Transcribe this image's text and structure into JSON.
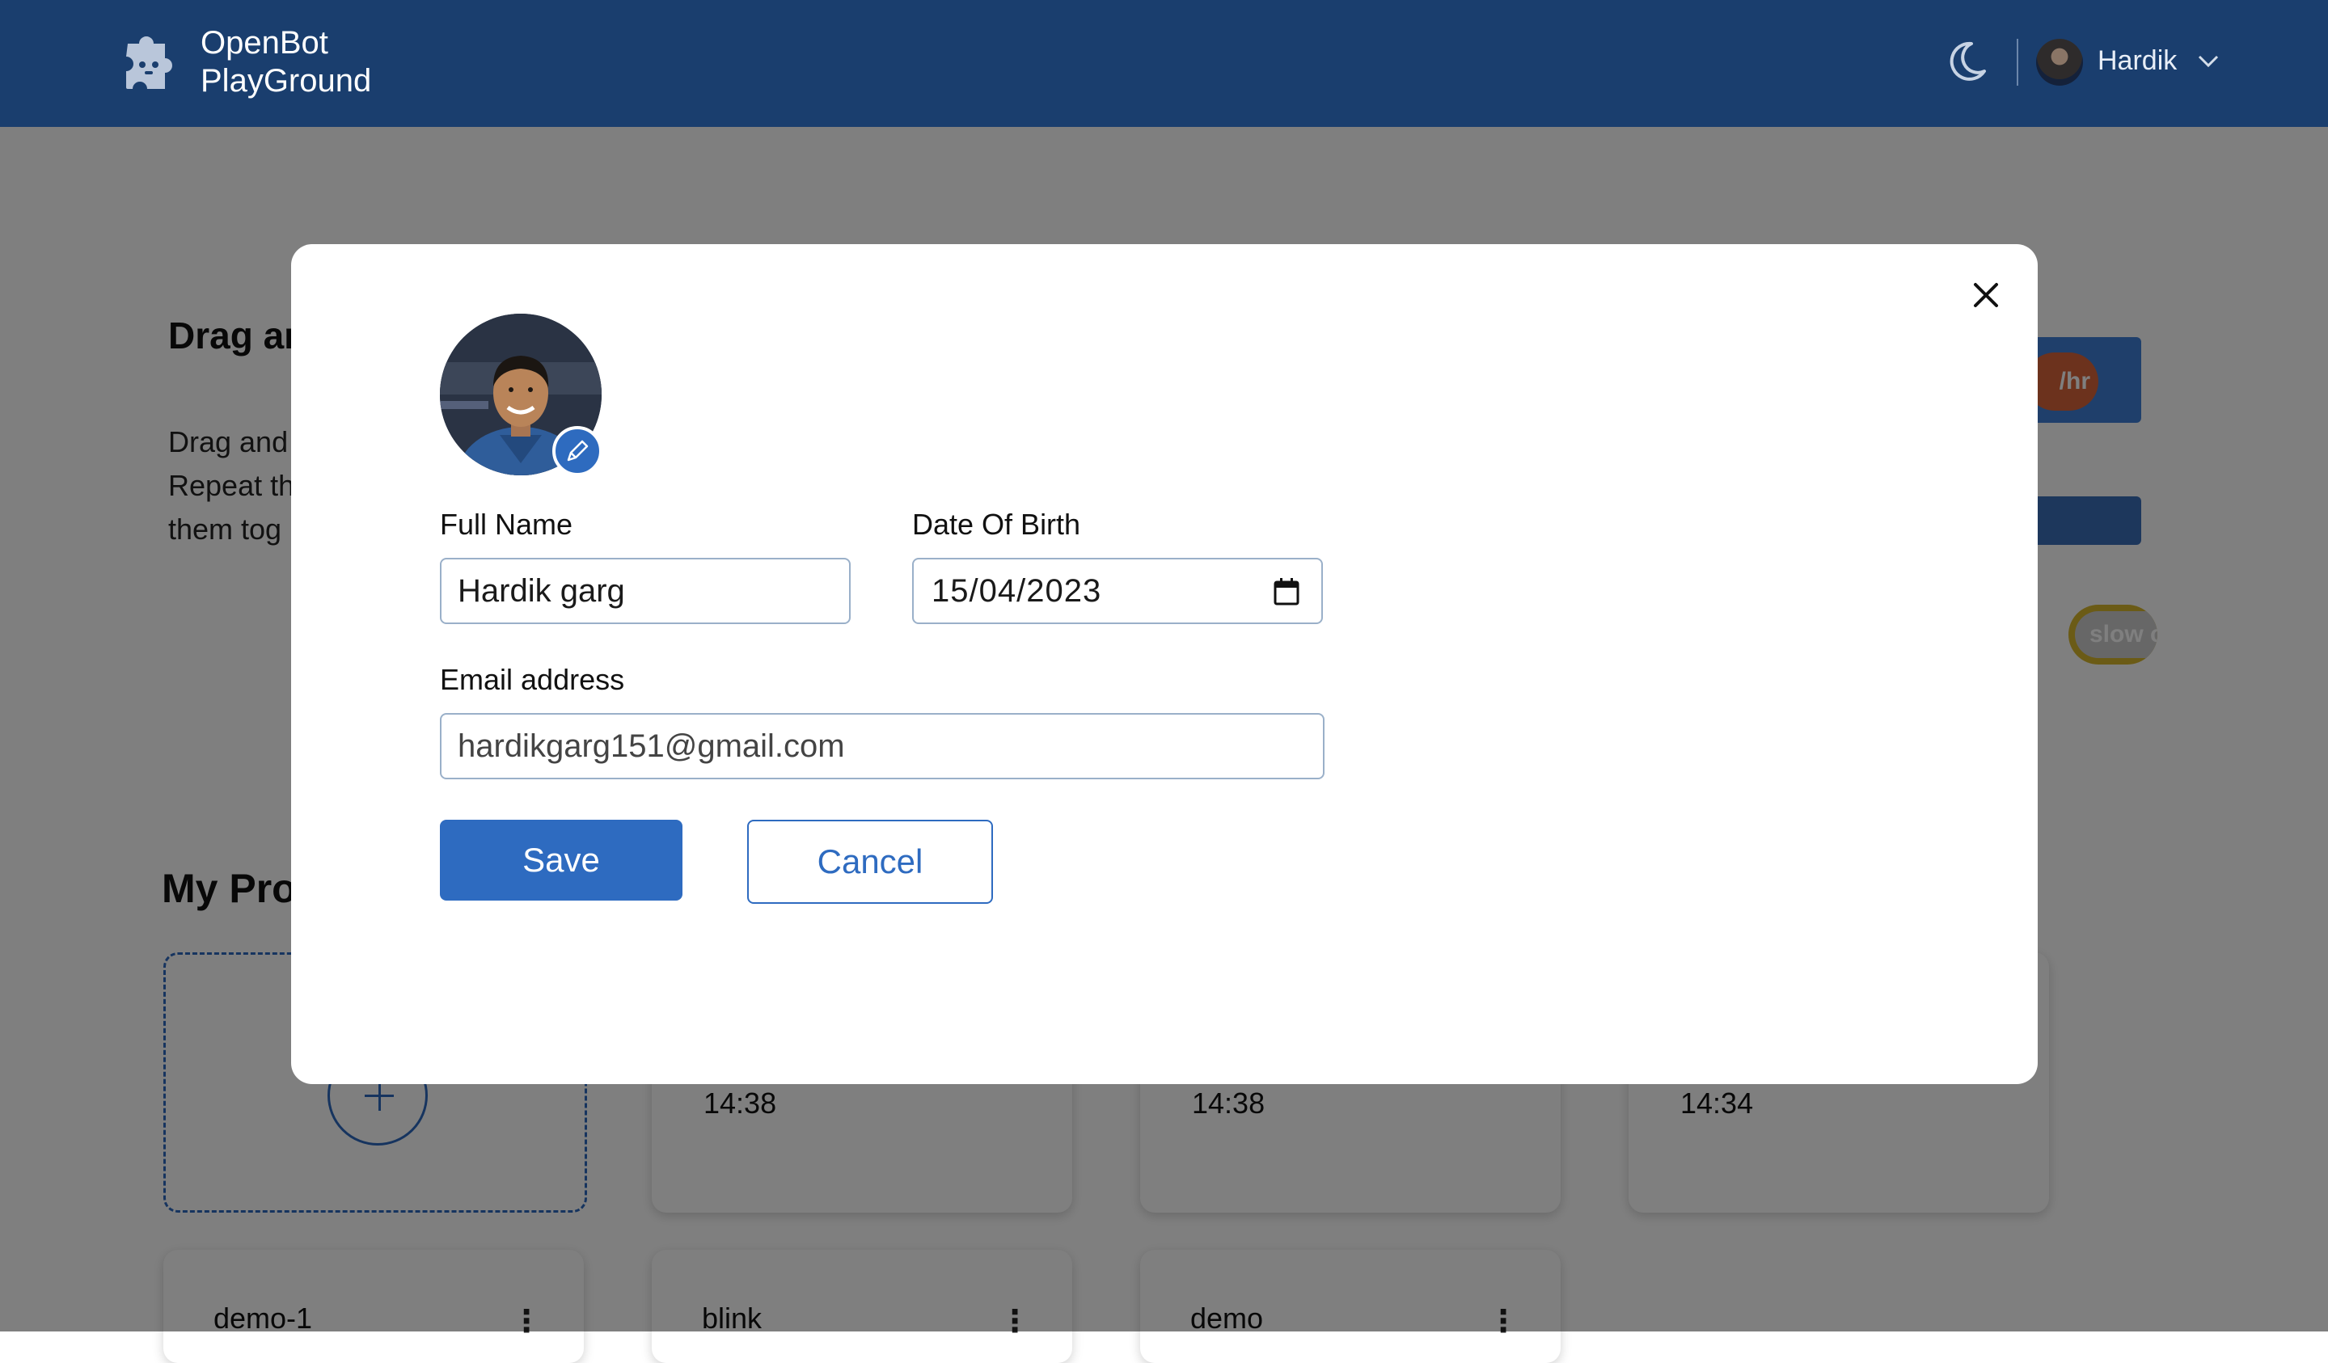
{
  "header": {
    "app_name_line1": "OpenBot",
    "app_name_line2": "PlayGround",
    "user_name": "Hardik",
    "background_color": "#1a3e6e"
  },
  "background_page": {
    "section_title": "Drag an",
    "description_lines": [
      "Drag and",
      "Repeat th",
      "them tog"
    ],
    "block_chip_text": "/hr",
    "slow_chip_text": "slow c",
    "projects_title": "My Proj",
    "project_cards_row1": [
      {
        "time": "14:38"
      },
      {
        "time": "14:38"
      },
      {
        "time": "14:34"
      }
    ],
    "project_cards_row2": [
      {
        "name": "demo-1"
      },
      {
        "name": "blink"
      },
      {
        "name": "demo"
      }
    ]
  },
  "modal": {
    "full_name_label": "Full Name",
    "full_name_value": "Hardik garg",
    "dob_label": "Date Of Birth",
    "dob_value": "15/04/2023",
    "email_label": "Email address",
    "email_value": "hardikgarg151@gmail.com",
    "save_label": "Save",
    "cancel_label": "Cancel",
    "accent_color": "#2e6bc0"
  },
  "icons": [
    "puzzle-logo-icon",
    "moon-icon",
    "chevron-down-icon",
    "close-icon",
    "pencil-icon",
    "calendar-icon",
    "plus-icon",
    "more-vertical-icon"
  ]
}
